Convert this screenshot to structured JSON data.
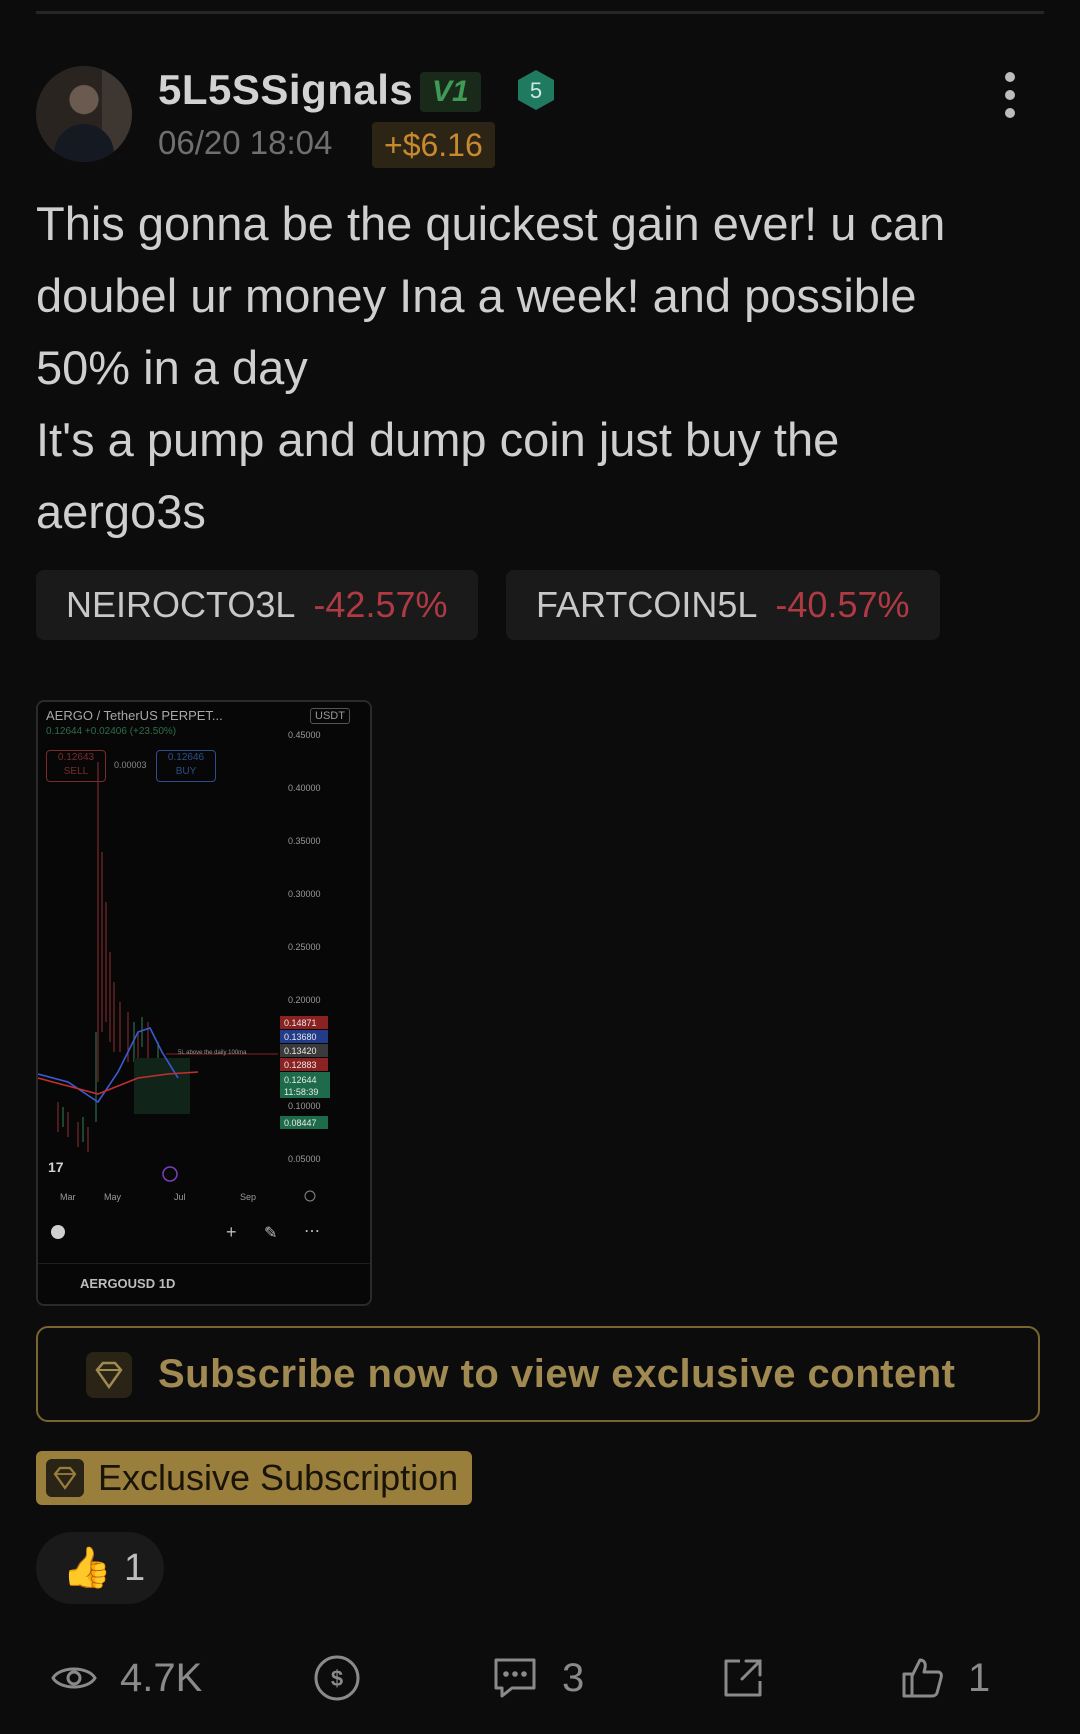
{
  "post": {
    "username": "5L5SSignals",
    "vip_badge": "V1",
    "level": "5",
    "timestamp": "06/20 18:04",
    "gain": "+$6.16",
    "text_lines": [
      "This gonna be the quickest gain ever! u can",
      "doubel ur money Ina a week! and possible",
      "50% in a day",
      "It's a pump and dump coin just buy the",
      "aergo3s"
    ]
  },
  "tickers": [
    {
      "symbol": "NEIROCTO3L",
      "change": "-42.57%"
    },
    {
      "symbol": "FARTCOIN5L",
      "change": "-40.57%"
    }
  ],
  "chart_image": {
    "pair": "AERGO / TetherUS PERPET...",
    "currency": "USDT",
    "sub": "0.12644 +0.02406 (+23.50%)",
    "sell_price": "0.12643",
    "sell_label": "SELL",
    "spread": "0.00003",
    "buy_price": "0.12646",
    "buy_label": "BUY",
    "symbol_bottom": "AERGOUSD 1D",
    "y_ticks": [
      "0.45000",
      "0.40000",
      "0.35000",
      "0.30000",
      "0.25000",
      "0.20000",
      "0.10000",
      "0.05000"
    ],
    "price_tags": [
      "0.14871",
      "0.13680",
      "0.13420",
      "0.12883",
      "0.12644",
      "11:58:39",
      "0.08447"
    ],
    "x_ticks": [
      "Mar",
      "May",
      "Jul",
      "Sep"
    ],
    "annotation": "5L above the daily 100ma"
  },
  "subscribe": {
    "label": "Subscribe now to view exclusive content"
  },
  "exclusive": {
    "label": "Exclusive Subscription"
  },
  "reaction": {
    "emoji": "👍",
    "count": "1"
  },
  "bottom_bar": {
    "views": "4.7K",
    "comments": "3",
    "likes": "1"
  },
  "colors": {
    "background": "#0c0c0c",
    "negative": "#b03a44",
    "gold": "#9a7f3c",
    "gain": "#c78a2e",
    "vip": "#3f9a55"
  }
}
